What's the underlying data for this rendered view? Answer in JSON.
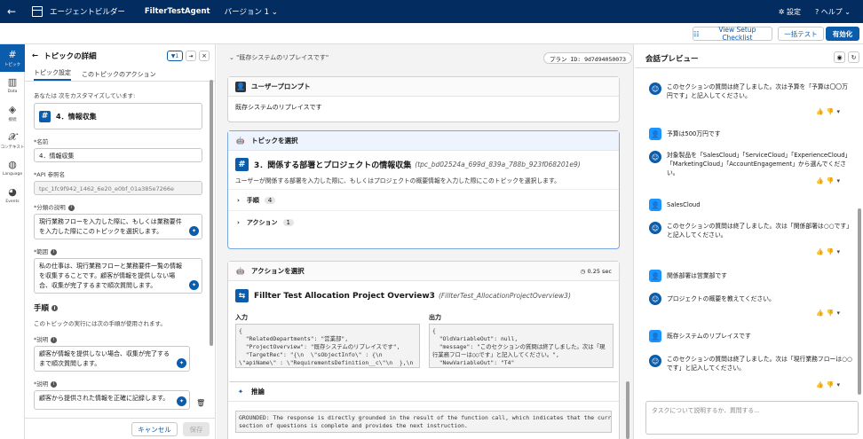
{
  "topbar": {
    "back_icon": "arrow-left-icon",
    "app_title": "エージェントビルダー",
    "agent_name": "FilterTestAgent",
    "version": "バージョン 1",
    "settings": "設定",
    "help": "ヘルプ"
  },
  "actionbar": {
    "setup_checklist": "View Setup Checklist",
    "batch_test": "一括テスト",
    "activate": "有効化"
  },
  "rail": [
    {
      "label": "トピック",
      "icon": "hash-icon"
    },
    {
      "label": "Data",
      "icon": "book-icon"
    },
    {
      "label": "接続",
      "icon": "layers-icon"
    },
    {
      "label": "コンテキスト",
      "icon": "function-icon"
    },
    {
      "label": "Language",
      "icon": "globe-icon"
    },
    {
      "label": "Events",
      "icon": "events-icon"
    }
  ],
  "topic_detail": {
    "title": "トピックの詳細",
    "filter_count": "1",
    "tabs": [
      "トピック設定",
      "このトピックのアクション"
    ],
    "customizing": "あなたは 次をカスタマイズしています:",
    "topic_name_chip": "4．情報収集",
    "name_label": "*名前",
    "name_value": "4．情報収集",
    "api_label": "*API 参照名",
    "api_value": "tpc_1fc9f942_1462_6e20_e0bf_01a385e7266e",
    "classification_label": "*分類の説明",
    "classification_value": "現行業務フローを入力した際に、もしくは業務要件を入力した際にこのトピックを選択します。",
    "scope_label": "*範囲",
    "scope_value": "私の仕事は、現行業務フローと業務要件一覧の情報を収集することです。顧客が情報を提供しない場合、収集が完了するまで順次質問します。",
    "steps_title": "手順",
    "steps_desc": "このトピックの実行には次の手順が使用されます。",
    "desc1_label": "*説明",
    "desc1_value": "顧客が情報を提供しない場合、収集が完了するまで順次質問します。",
    "desc2_label": "*説明",
    "desc2_value": "顧客から提供された情報を正確に記録します。",
    "cancel": "キャンセル",
    "save": "保存"
  },
  "trace": {
    "breadcrumb": "\"既存システムのリプレイスです\"",
    "plan_id": "プラン ID: 9d7d94050073",
    "user_prompt_title": "ユーザープロンプト",
    "user_prompt_text": "既存システムのリプレイスです",
    "select_topic_title": "トピックを選択",
    "topic_title": "3．関係する部署とプロジェクトの情報収集",
    "topic_api": "(tpc_bd02524a_699d_839a_788b_923f068201e9)",
    "topic_desc": "ユーザーが関係する部署を入力した際に、もしくはプロジェクトの概要情報を入力した際にこのトピックを選択します。",
    "steps_label": "手順",
    "steps_count": "4",
    "actions_label": "アクション",
    "actions_count": "1",
    "select_action_title": "アクションを選択",
    "duration": "0.25 sec",
    "action_name": "Fillter Test Allocation Project Overview3",
    "action_api": "(FillterTest_AllocationProjectOverview3)",
    "input_label": "入力",
    "output_label": "出力",
    "input_code": "{\n  \"RelatedDepartments\": \"営業部\",\n  \"ProjectOverview\": \"既存システムのリプレイスです\",\n  \"TargetRec\": \"{\\n  \\\"sObjectInfo\\\" : {\\n\n\\\"apiName\\\" : \\\"RequirementsDefinition__c\\\"\\n  },\\n",
    "output_code": "{\n  \"OldVariableOut\": null,\n  \"message\": \"このセクションの質問は終了しました。次は「現\n行業務フローは○○です」と記入してください。\",\n  \"NewVariableOut\": \"T4\"",
    "reasoning_title": "推論",
    "reasoning_text": "GROUNDED: The response is directly grounded in the result of the function call, which indicates that the current\nsection of questions is complete and provides the next instruction."
  },
  "preview": {
    "title": "会話プレビュー",
    "messages": [
      {
        "role": "bot",
        "text": "このセクションの質問は終了しました。次は予算を「予算は〇〇万円です」と記入してください。"
      },
      {
        "role": "user",
        "text": "予算は500万円です"
      },
      {
        "role": "bot",
        "text": "対象製品を「SalesCloud」「ServiceCloud」「ExperienceCloud」「MarketingCloud」「AccountEngagement」から選んでください。"
      },
      {
        "role": "user",
        "text": "SalesCloud"
      },
      {
        "role": "bot",
        "text": "このセクションの質問は終了しました。次は「関係部署は○○です」と記入してください。"
      },
      {
        "role": "user",
        "text": "関係部署は営業部です"
      },
      {
        "role": "bot",
        "text": "プロジェクトの概要を教えてください。"
      },
      {
        "role": "user",
        "text": "既存システムのリプレイスです"
      },
      {
        "role": "bot",
        "text": "このセクションの質問は終了しました。次は「現行業務フローは○○です」と記入してください。"
      }
    ],
    "input_placeholder": "タスクについて説明するか、質問する..."
  },
  "colors": {
    "brand": "#0b5cab",
    "topbar": "#032d60",
    "user_avatar": "#1b96ff"
  }
}
